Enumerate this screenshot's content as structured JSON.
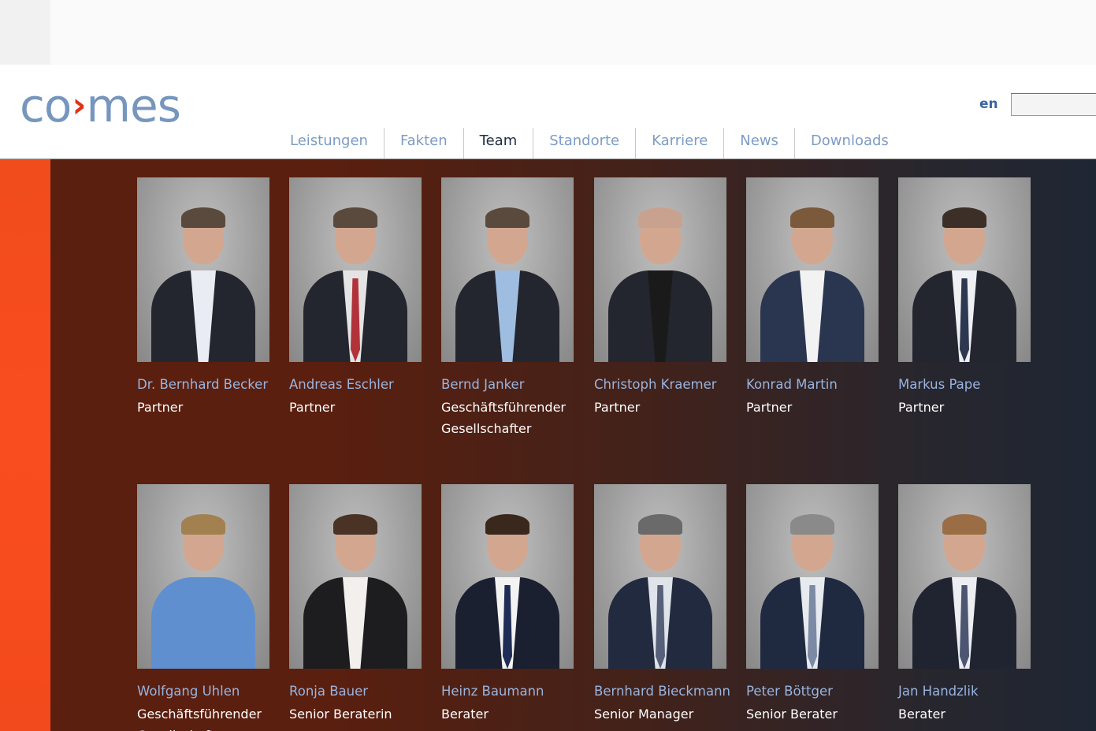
{
  "brand": {
    "logo_left": "co",
    "logo_arrow": "›",
    "logo_right": "mes"
  },
  "header": {
    "language_link": "en",
    "search_placeholder": ""
  },
  "nav": {
    "items": [
      {
        "label": "Leistungen"
      },
      {
        "label": "Fakten"
      },
      {
        "label": "Team",
        "active": true
      },
      {
        "label": "Standorte"
      },
      {
        "label": "Karriere"
      },
      {
        "label": "News"
      },
      {
        "label": "Downloads"
      }
    ]
  },
  "team": [
    {
      "name": "Dr. Bernhard Becker",
      "role": "Partner",
      "shirt": "#e9edf3",
      "tie": "none"
    },
    {
      "name": "Andreas Eschler",
      "role": "Partner",
      "shirt": "#e4e4e4",
      "tie": "#b2323a"
    },
    {
      "name": "Bernd Janker",
      "role": "Geschäftsführender Gesellschafter",
      "shirt": "#9fbde0",
      "tie": "none"
    },
    {
      "name": "Christoph Kraemer",
      "role": "Partner",
      "shirt": "#1a1a1a",
      "tie": "none"
    },
    {
      "name": "Konrad Martin",
      "role": "Partner",
      "shirt": "#f2f2f2",
      "tie": "none"
    },
    {
      "name": "Markus Pape",
      "role": "Partner",
      "shirt": "#eef0f3",
      "tie": "#2e3750"
    },
    {
      "name": "Wolfgang Uhlen",
      "role": "Geschäftsführender Gesellschafter",
      "shirt": "#5f8fcf",
      "tie": "none"
    },
    {
      "name": "Ronja Bauer",
      "role": "Senior Beraterin",
      "shirt": "#f2efec",
      "tie": "none"
    },
    {
      "name": "Heinz Baumann",
      "role": "Berater",
      "shirt": "#f3f3f3",
      "tie": "#1f2c55"
    },
    {
      "name": "Bernhard Bieckmann",
      "role": "Senior Manager",
      "shirt": "#dfe3ea",
      "tie": "#566078"
    },
    {
      "name": "Peter Böttger",
      "role": "Senior Berater",
      "shirt": "#e7eaee",
      "tie": "#7c8aa5"
    },
    {
      "name": "Jan Handzlik",
      "role": "Berater",
      "shirt": "#eceef1",
      "tie": "#4d5670"
    }
  ]
}
